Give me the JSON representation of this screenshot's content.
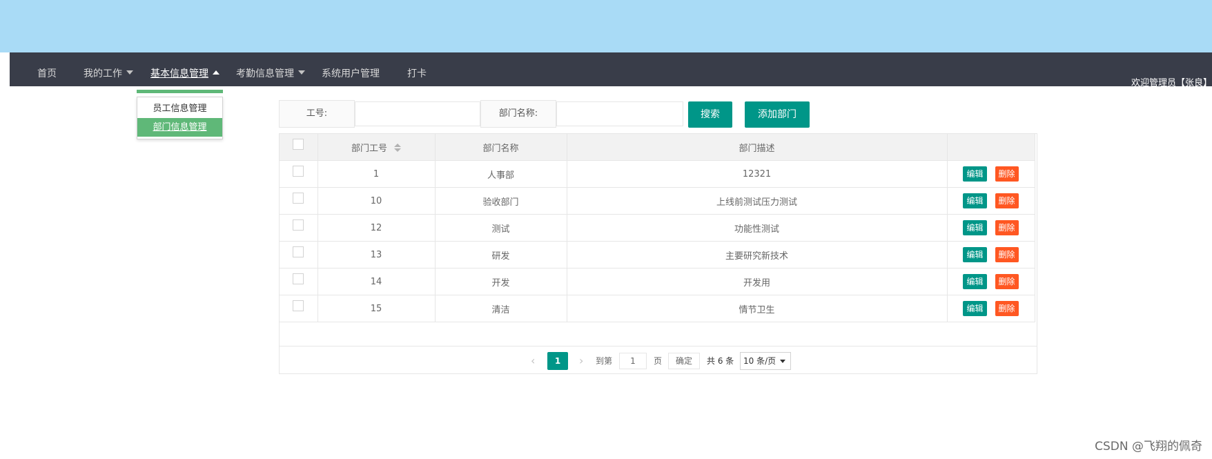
{
  "colors": {
    "banner": "#a9dbf6",
    "navbar": "#393d49",
    "primary": "#009688",
    "danger": "#ff5722",
    "menu_accent": "#5fb878"
  },
  "nav": {
    "items": [
      {
        "label": "首页"
      },
      {
        "label": "我的工作",
        "caret": "chevron-down-icon"
      },
      {
        "label": "基本信息管理",
        "caret": "chevron-up-icon"
      },
      {
        "label": "考勤信息管理",
        "caret": "chevron-down-icon"
      },
      {
        "label": "系统用户管理"
      },
      {
        "label": "打卡"
      }
    ],
    "welcome": "欢迎管理员【张良】"
  },
  "dropdown": {
    "items": [
      {
        "label": "员工信息管理"
      },
      {
        "label": "部门信息管理",
        "selected": true
      }
    ]
  },
  "search": {
    "id_label": "工号:",
    "id_value": "",
    "dept_label": "部门名称:",
    "dept_value": "",
    "search_button": "搜索",
    "add_button": "添加部门"
  },
  "table": {
    "columns": [
      "",
      "部门工号",
      "部门名称",
      "部门描述",
      ""
    ],
    "rows": [
      {
        "id": "1",
        "name": "人事部",
        "desc": "12321"
      },
      {
        "id": "10",
        "name": "验收部门",
        "desc": "上线前测试压力测试"
      },
      {
        "id": "12",
        "name": "测试",
        "desc": "功能性测试"
      },
      {
        "id": "13",
        "name": "研发",
        "desc": "主要研究新技术"
      },
      {
        "id": "14",
        "name": "开发",
        "desc": "开发用"
      },
      {
        "id": "15",
        "name": "清洁",
        "desc": "情节卫生"
      }
    ],
    "edit_label": "编辑",
    "delete_label": "删除"
  },
  "pager": {
    "current": "1",
    "goto_label": "到第",
    "goto_value": "1",
    "page_label": "页",
    "confirm_label": "确定",
    "total_label": "共 6 条",
    "page_size": "10 条/页"
  },
  "watermark": "CSDN @飞翔的佩奇"
}
